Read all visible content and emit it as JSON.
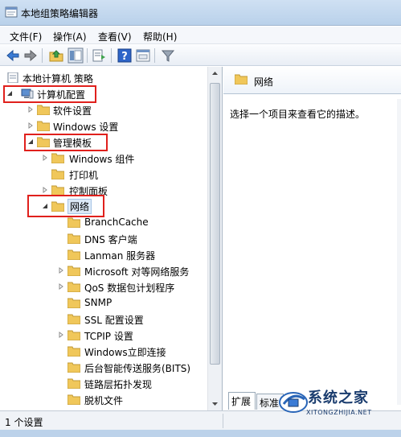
{
  "window": {
    "title": "本地组策略编辑器"
  },
  "menu": {
    "items": [
      "文件(F)",
      "操作(A)",
      "查看(V)",
      "帮助(H)"
    ]
  },
  "toolbar": {
    "icons": [
      "back-arrow-icon",
      "forward-arrow-icon",
      "up-folder-icon",
      "show-hide-tree-icon",
      "export-list-icon",
      "help-icon",
      "properties-icon",
      "filter-icon"
    ]
  },
  "tree": {
    "root": "本地计算机 策略",
    "computer_config": "计算机配置",
    "software_settings": "软件设置",
    "windows_settings": "Windows 设置",
    "admin_templates": "管理模板",
    "windows_components": "Windows 组件",
    "printers": "打印机",
    "control_panel": "控制面板",
    "network": "网络",
    "network_children": [
      "BranchCache",
      "DNS 客户端",
      "Lanman 服务器",
      "Microsoft 对等网络服务",
      "QoS 数据包计划程序",
      "SNMP",
      "SSL 配置设置",
      "TCPIP 设置",
      "Windows立即连接",
      "后台智能传送服务(BITS)",
      "链路层拓扑发现",
      "脱机文件"
    ]
  },
  "right": {
    "title": "网络",
    "description": "选择一个项目来查看它的描述。",
    "tabs": [
      "扩展",
      "标准"
    ]
  },
  "status": {
    "text": "1 个设置"
  },
  "watermark": {
    "brand": "系统之家",
    "url": "XITONGZHIJIA.NET"
  },
  "colors": {
    "highlight": "#e0201c",
    "folder": "#f0c75a",
    "titlebar": "#c4d8ef"
  }
}
